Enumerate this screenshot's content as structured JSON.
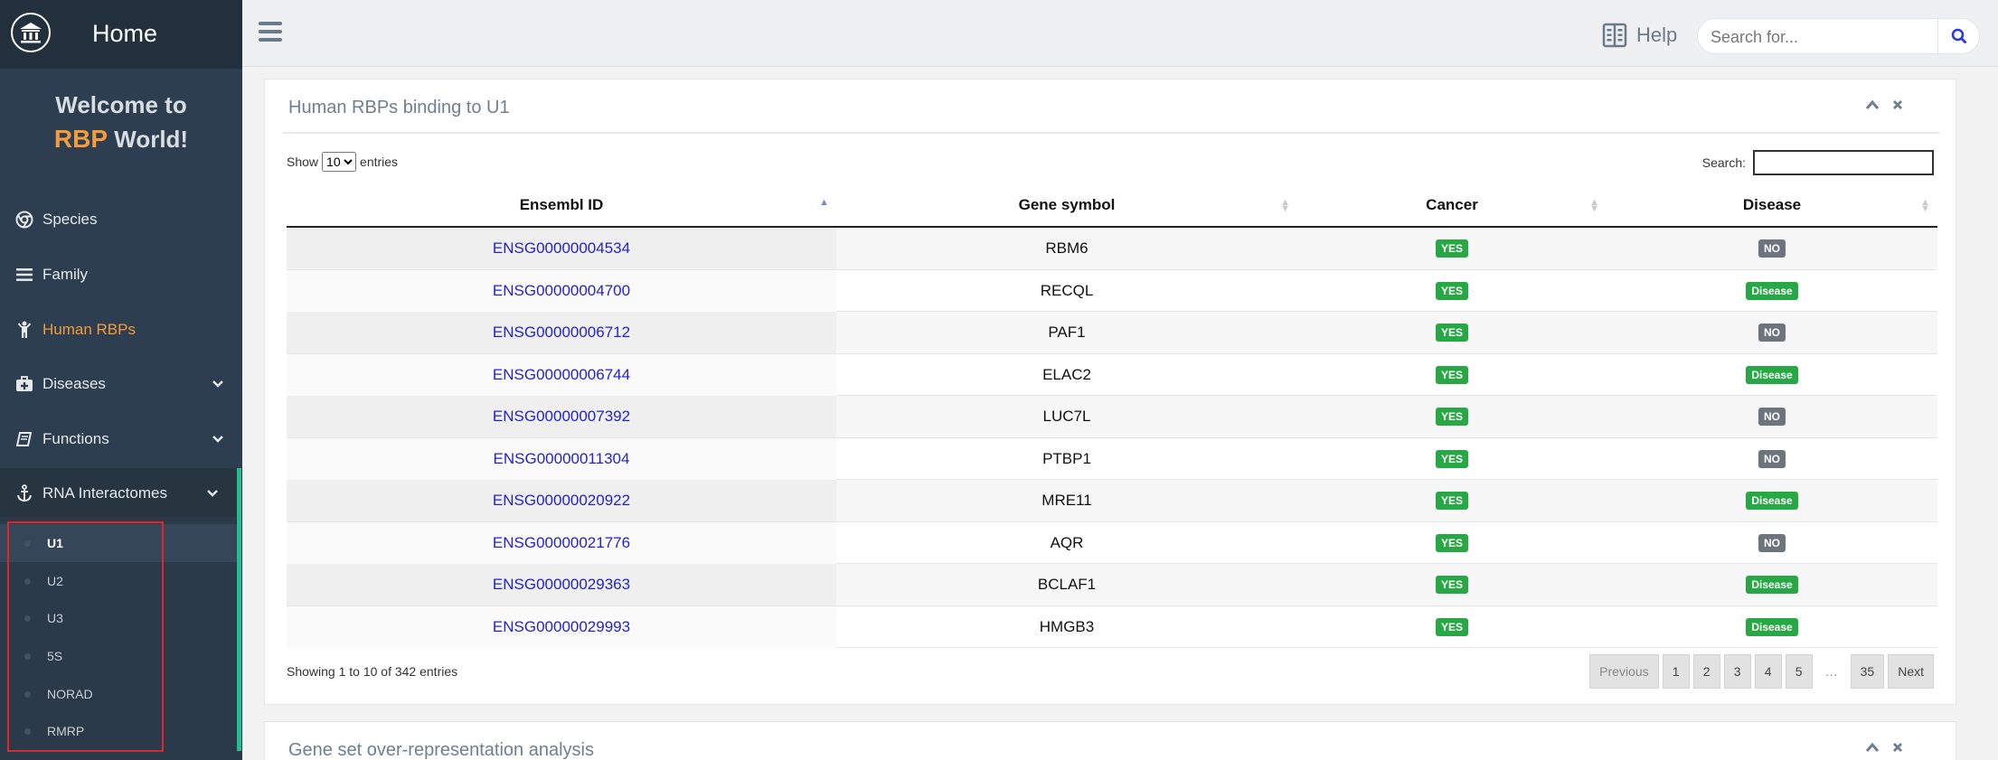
{
  "sidebar": {
    "brand_title": "Home",
    "welcome_line1": "Welcome to",
    "welcome_rbp": "RBP",
    "welcome_world": "World!",
    "items": [
      {
        "label": "Species",
        "icon": "chrome-icon"
      },
      {
        "label": "Family",
        "icon": "bars-icon"
      },
      {
        "label": "Human RBPs",
        "icon": "child-icon",
        "active": true
      },
      {
        "label": "Diseases",
        "icon": "medkit-icon",
        "has_submenu": true
      },
      {
        "label": "Functions",
        "icon": "book-icon",
        "has_submenu": true
      },
      {
        "label": "RNA Interactomes",
        "icon": "anchor-icon",
        "has_submenu": true,
        "open": true
      }
    ],
    "sub_items": [
      {
        "label": "U1",
        "selected": true
      },
      {
        "label": "U2"
      },
      {
        "label": "U3"
      },
      {
        "label": "5S"
      },
      {
        "label": "NORAD"
      },
      {
        "label": "RMRP"
      }
    ],
    "accent_color": "#f39c3d"
  },
  "topbar": {
    "help_label": "Help",
    "search_placeholder": "Search for..."
  },
  "panel": {
    "title": "Human RBPs binding to U1",
    "show_label": "Show",
    "entries_label": "entries",
    "page_length": "10",
    "search_label": "Search:",
    "columns": [
      "Ensembl ID",
      "Gene symbol",
      "Cancer",
      "Disease"
    ],
    "rows": [
      {
        "id": "ENSG00000004534",
        "symbol": "RBM6",
        "cancer": "YES",
        "disease": "NO"
      },
      {
        "id": "ENSG00000004700",
        "symbol": "RECQL",
        "cancer": "YES",
        "disease": "Disease"
      },
      {
        "id": "ENSG00000006712",
        "symbol": "PAF1",
        "cancer": "YES",
        "disease": "NO"
      },
      {
        "id": "ENSG00000006744",
        "symbol": "ELAC2",
        "cancer": "YES",
        "disease": "Disease"
      },
      {
        "id": "ENSG00000007392",
        "symbol": "LUC7L",
        "cancer": "YES",
        "disease": "NO"
      },
      {
        "id": "ENSG00000011304",
        "symbol": "PTBP1",
        "cancer": "YES",
        "disease": "NO"
      },
      {
        "id": "ENSG00000020922",
        "symbol": "MRE11",
        "cancer": "YES",
        "disease": "Disease"
      },
      {
        "id": "ENSG00000021776",
        "symbol": "AQR",
        "cancer": "YES",
        "disease": "NO"
      },
      {
        "id": "ENSG00000029363",
        "symbol": "BCLAF1",
        "cancer": "YES",
        "disease": "Disease"
      },
      {
        "id": "ENSG00000029993",
        "symbol": "HMGB3",
        "cancer": "YES",
        "disease": "Disease"
      }
    ],
    "info": "Showing 1 to 10 of 342 entries",
    "pagination": [
      "Previous",
      "1",
      "2",
      "3",
      "4",
      "5",
      "…",
      "35",
      "Next"
    ]
  },
  "panel2": {
    "title": "Gene set over-representation analysis"
  },
  "colors": {
    "sidebar_bg": "#2d3e50",
    "badge_green": "#28a745",
    "badge_gray": "#6c757d",
    "link_blue": "#2323c8",
    "highlight_red": "#e0252b"
  }
}
